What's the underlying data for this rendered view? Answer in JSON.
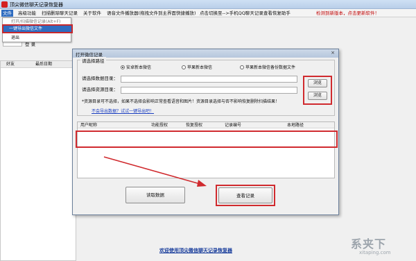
{
  "window": {
    "title": "顶尖微信聊天记录恢复器"
  },
  "menu": {
    "items": [
      {
        "label": "文件"
      },
      {
        "label": "高级功能"
      },
      {
        "label": "扫描删除聊天记录"
      },
      {
        "label": "关于软件"
      },
      {
        "label": "语音文件播放器(拖拽文件到主界面快捷播放)"
      },
      {
        "label": "点击切换至-->手机QQ聊天记录查看恢复助手"
      },
      {
        "label": "检测到新版本，点击更新软件！"
      }
    ]
  },
  "file_menu": {
    "items": [
      {
        "label": "打开/扫描微信记录(Alt+F)"
      },
      {
        "label": "一键导出微信文件"
      },
      {
        "label": "退出"
      }
    ]
  },
  "left_panel": {
    "login_label": "登 录",
    "columns": [
      "好友",
      "最后日期"
    ]
  },
  "dialog": {
    "title": "打开微信记录",
    "close_glyph": "×",
    "group_label": "请选择路径",
    "radios": [
      {
        "label": "安卓新本微信",
        "checked": true
      },
      {
        "label": "苹果新本微信",
        "checked": false
      },
      {
        "label": "苹果新本微信备份数据文件",
        "checked": false
      }
    ],
    "data_dir_label": "请选择数据目录：",
    "resource_dir_label": "请选择资源目录：",
    "data_dir_value": "",
    "resource_dir_value": "",
    "browse_label": "浏览",
    "browse_label_2": "浏览",
    "note": "*资源目录可不选择，如果不选择会影响正常查看语音和图片！资源目录选择与否不影响恢复删除扫描结果！",
    "help_link": "不会导出数据？试试一键导出吧！",
    "columns": [
      "用户昵称",
      "功能授权",
      "恢复授权",
      "记录编号",
      "本地路径"
    ],
    "read_button": "读取数据",
    "view_button": "查看记录"
  },
  "footer": {
    "link": "欢迎使用顶尖微信聊天记录恢复器",
    "watermark_big": "系夹下",
    "watermark_small": "xitaping.com"
  },
  "colors": {
    "highlight_red": "#d02a2e",
    "menu_blue": "#2f6cc0",
    "link_blue": "#1a3e9c"
  }
}
